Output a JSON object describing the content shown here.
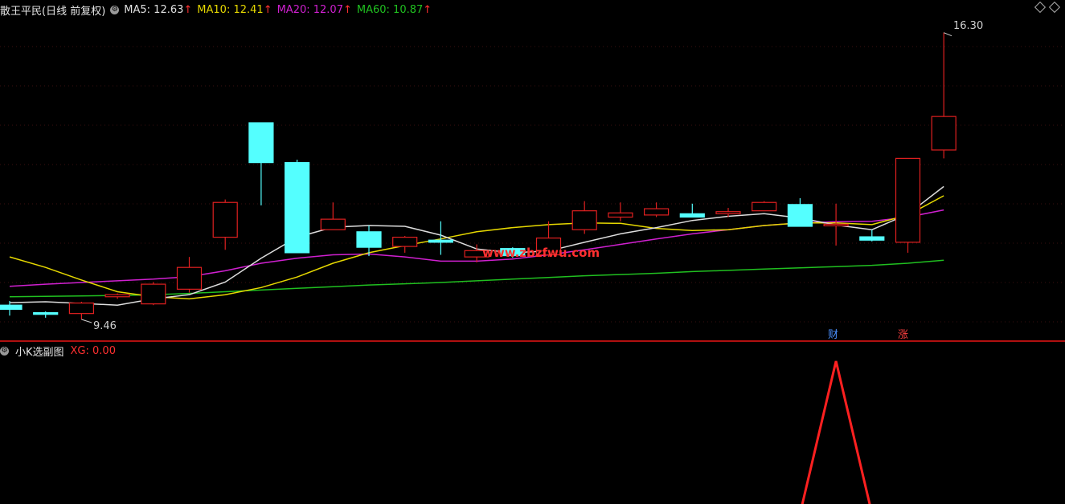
{
  "header": {
    "formula_name": "散王平民(日线 前复权)",
    "ma5": "MA5: 12.63",
    "ma10": "MA10: 12.41",
    "ma20": "MA20: 12.07",
    "ma60": "MA60: 10.87",
    "arrow": "↑"
  },
  "sub": {
    "name": "小K选副图",
    "xg": "XG: 0.00"
  },
  "watermark": "www.zbzfwu.com",
  "markers": {
    "cai": "财",
    "zhang": "涨"
  },
  "colors": {
    "up": "#e02020",
    "down": "#54ffff",
    "ma5": "#dddddd",
    "ma10": "#e6d800",
    "ma20": "#d020d0",
    "ma60": "#20c020",
    "xg": "#ff2020",
    "divider": "#b01010"
  },
  "chart_data": {
    "type": "candlestick",
    "ylim": [
      9.0,
      16.6
    ],
    "high_label": "16.30",
    "low_label": "9.46",
    "candles": [
      {
        "o": 9.8,
        "c": 9.7,
        "h": 9.9,
        "l": 9.55
      },
      {
        "o": 9.62,
        "c": 9.58,
        "h": 9.65,
        "l": 9.5
      },
      {
        "o": 9.6,
        "c": 9.85,
        "h": 9.88,
        "l": 9.46
      },
      {
        "o": 10.0,
        "c": 10.05,
        "h": 10.08,
        "l": 9.95
      },
      {
        "o": 9.83,
        "c": 10.3,
        "h": 10.35,
        "l": 9.8
      },
      {
        "o": 10.18,
        "c": 10.7,
        "h": 10.95,
        "l": 10.1
      },
      {
        "o": 11.42,
        "c": 12.25,
        "h": 12.32,
        "l": 11.12
      },
      {
        "o": 14.15,
        "c": 13.2,
        "h": 14.15,
        "l": 12.18
      },
      {
        "o": 13.2,
        "c": 11.05,
        "h": 13.27,
        "l": 11.05
      },
      {
        "o": 11.6,
        "c": 11.85,
        "h": 12.25,
        "l": 11.6
      },
      {
        "o": 11.55,
        "c": 11.18,
        "h": 11.7,
        "l": 10.97
      },
      {
        "o": 11.2,
        "c": 11.42,
        "h": 11.45,
        "l": 11.05
      },
      {
        "o": 11.35,
        "c": 11.3,
        "h": 11.8,
        "l": 11.0
      },
      {
        "o": 10.95,
        "c": 11.1,
        "h": 11.25,
        "l": 10.82
      },
      {
        "o": 11.15,
        "c": 10.98,
        "h": 11.18,
        "l": 10.93
      },
      {
        "o": 11.0,
        "c": 11.4,
        "h": 11.8,
        "l": 10.95
      },
      {
        "o": 11.6,
        "c": 12.05,
        "h": 12.28,
        "l": 11.5
      },
      {
        "o": 11.9,
        "c": 12.0,
        "h": 12.25,
        "l": 11.8
      },
      {
        "o": 11.95,
        "c": 12.1,
        "h": 12.25,
        "l": 11.9
      },
      {
        "o": 11.98,
        "c": 11.9,
        "h": 12.22,
        "l": 11.9
      },
      {
        "o": 11.98,
        "c": 12.03,
        "h": 12.12,
        "l": 11.9
      },
      {
        "o": 12.05,
        "c": 12.25,
        "h": 12.28,
        "l": 12.05
      },
      {
        "o": 12.2,
        "c": 11.68,
        "h": 12.35,
        "l": 11.68
      },
      {
        "o": 11.73,
        "c": 11.73,
        "h": 12.22,
        "l": 11.22
      },
      {
        "o": 11.43,
        "c": 11.35,
        "h": 11.6,
        "l": 11.32
      },
      {
        "o": 11.3,
        "c": 13.3,
        "h": 13.3,
        "l": 11.05
      },
      {
        "o": 13.5,
        "c": 14.3,
        "h": 16.3,
        "l": 13.3
      }
    ],
    "ma5": [
      9.86,
      9.88,
      9.84,
      9.8,
      9.95,
      10.05,
      10.35,
      10.92,
      11.42,
      11.66,
      11.7,
      11.68,
      11.47,
      11.14,
      11.05,
      11.09,
      11.3,
      11.5,
      11.65,
      11.82,
      11.92,
      11.98,
      11.88,
      11.71,
      11.6,
      11.97,
      12.63
    ],
    "ma10": [
      10.95,
      10.7,
      10.4,
      10.12,
      10.0,
      9.95,
      10.05,
      10.22,
      10.47,
      10.8,
      11.05,
      11.22,
      11.38,
      11.55,
      11.65,
      11.72,
      11.76,
      11.75,
      11.63,
      11.58,
      11.6,
      11.7,
      11.76,
      11.76,
      11.72,
      11.95,
      12.41
    ],
    "ma20": [
      10.25,
      10.3,
      10.34,
      10.38,
      10.42,
      10.48,
      10.62,
      10.8,
      10.92,
      11.0,
      11.02,
      10.95,
      10.85,
      10.85,
      10.9,
      11.0,
      11.12,
      11.25,
      11.38,
      11.5,
      11.6,
      11.7,
      11.76,
      11.79,
      11.8,
      11.9,
      12.07
    ],
    "ma60": [
      10.0,
      10.01,
      10.02,
      10.03,
      10.05,
      10.08,
      10.12,
      10.16,
      10.2,
      10.24,
      10.28,
      10.31,
      10.34,
      10.38,
      10.42,
      10.46,
      10.5,
      10.53,
      10.56,
      10.6,
      10.63,
      10.66,
      10.69,
      10.72,
      10.75,
      10.8,
      10.87
    ],
    "xg": [
      0,
      0,
      0,
      0,
      0,
      0,
      0,
      0,
      0,
      0,
      0,
      0,
      0,
      0,
      0,
      0,
      0,
      0,
      0,
      0,
      0,
      0,
      0,
      1,
      0,
      0,
      0
    ]
  }
}
